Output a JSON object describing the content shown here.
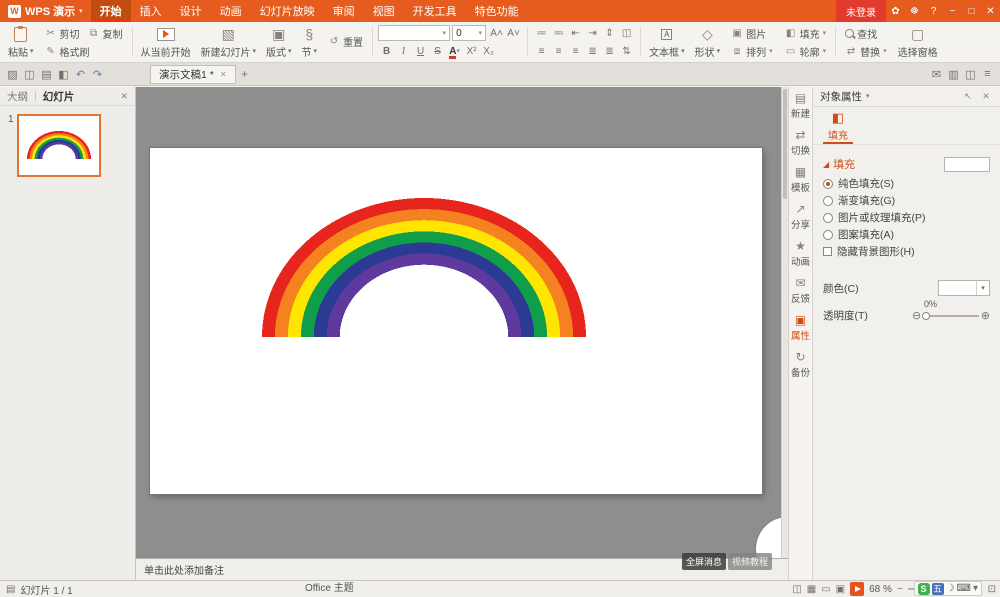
{
  "titlebar": {
    "logo_mark": "W",
    "logo": "WPS 演示",
    "login": "未登录",
    "tabs": [
      {
        "label": "开始",
        "active": true
      },
      {
        "label": "插入"
      },
      {
        "label": "设计"
      },
      {
        "label": "动画"
      },
      {
        "label": "幻灯片放映"
      },
      {
        "label": "审阅"
      },
      {
        "label": "视图"
      },
      {
        "label": "开发工具"
      },
      {
        "label": "特色功能"
      }
    ]
  },
  "ribbon": {
    "paste": "粘贴",
    "cut": "剪切",
    "copy": "复制",
    "format_painter": "格式刷",
    "play_from_current": "从当前开始",
    "new_slide": "新建幻灯片",
    "layout": "版式",
    "section": "节",
    "reset": "重置",
    "font_size": "0",
    "textbox": "文本框",
    "shapes": "形状",
    "picture": "图片",
    "arrange": "排列",
    "fill": "填充",
    "outline": "轮廓",
    "find": "查找",
    "replace": "替换",
    "selection_pane": "选择窗格"
  },
  "docbar": {
    "tab_title": "演示文稿1 *"
  },
  "outline_panel": {
    "tab_outline": "大纲",
    "tab_slides": "幻灯片",
    "slide_number": "1"
  },
  "slide": {
    "rainbow_colors": [
      "#e8251d",
      "#f58220",
      "#ffe600",
      "#119e4b",
      "#2b3a92",
      "#5f3a9e"
    ]
  },
  "notes": {
    "placeholder": "单击此处添加备注"
  },
  "right_toolbar": {
    "items": [
      {
        "icon": "▤",
        "label": "新建"
      },
      {
        "icon": "⇄",
        "label": "切换"
      },
      {
        "icon": "▦",
        "label": "模板"
      },
      {
        "icon": "↗",
        "label": "分享"
      },
      {
        "icon": "★",
        "label": "动画"
      },
      {
        "icon": "✉",
        "label": "反馈"
      },
      {
        "icon": "▣",
        "label": "属性",
        "active": true
      },
      {
        "icon": "↻",
        "label": "备份"
      }
    ]
  },
  "props": {
    "title": "对象属性",
    "tab_fill": "填充",
    "section_fill": "填充",
    "fill_options": [
      {
        "label": "纯色填充(S)",
        "selected": true
      },
      {
        "label": "渐变填充(G)"
      },
      {
        "label": "图片或纹理填充(P)"
      },
      {
        "label": "图案填充(A)"
      }
    ],
    "hide_bg": "隐藏背景图形(H)",
    "color_label": "颜色(C)",
    "transparency_label": "透明度(T)",
    "transparency_value": "0%"
  },
  "statusbar": {
    "slide_info": "幻灯片 1 / 1",
    "theme": "Office 主题",
    "zoom": "68 %"
  },
  "overlays": {
    "badge1": "全屏消息",
    "badge2": "视频教程",
    "ime_letter": "S",
    "ime_mode": "五"
  },
  "icons": {
    "caret": "▾",
    "skin": "✿",
    "settings": "☸",
    "help": "?",
    "minimize": "−",
    "maximize": "□",
    "close": "✕",
    "open": "▨",
    "save": "◫",
    "print": "▤",
    "preview": "◧",
    "undo": "↶",
    "redo": "↷",
    "msg": "✉",
    "panel": "▥",
    "window": "◫",
    "menu": "≡",
    "tab_close": "✕",
    "tab_new": "+",
    "cut": "✂",
    "copy": "⧉",
    "format_painter": "✎",
    "new_slide": "▧",
    "layout": "▣",
    "section": "§",
    "reset": "↺",
    "font_up": "A˄",
    "font_down": "A˅",
    "bold": "B",
    "italic": "I",
    "underline": "U",
    "strike": "S",
    "font_color": "A",
    "sup": "X²",
    "sub": "X₂",
    "bullets": "≔",
    "numbering": "≕",
    "indent_dec": "⇤",
    "indent_inc": "⇥",
    "line_spacing": "⇕",
    "columns": "◫",
    "align_left": "≡",
    "align_center": "≡",
    "align_right": "≡",
    "justify": "≣",
    "distribute": "≣",
    "text_direction": "⇅",
    "textbox_letter": "A",
    "shapes": "◇",
    "picture": "▣",
    "arrange": "⧈",
    "fill_bucket": "◧",
    "outline": "▭",
    "replace": "⇄",
    "selection": "▢",
    "undock": "↖",
    "panel_close": "✕",
    "expand": "◢",
    "minus_circle": "⊖",
    "plus_circle": "⊕",
    "view_normal": "◫",
    "view_sorter": "▦",
    "view_read": "▭",
    "view_show": "▣",
    "zoom_minus": "−",
    "zoom_plus": "+",
    "fit": "⊡",
    "moon": "☽",
    "keyboard": "⌨",
    "notes_icon": "▤"
  }
}
